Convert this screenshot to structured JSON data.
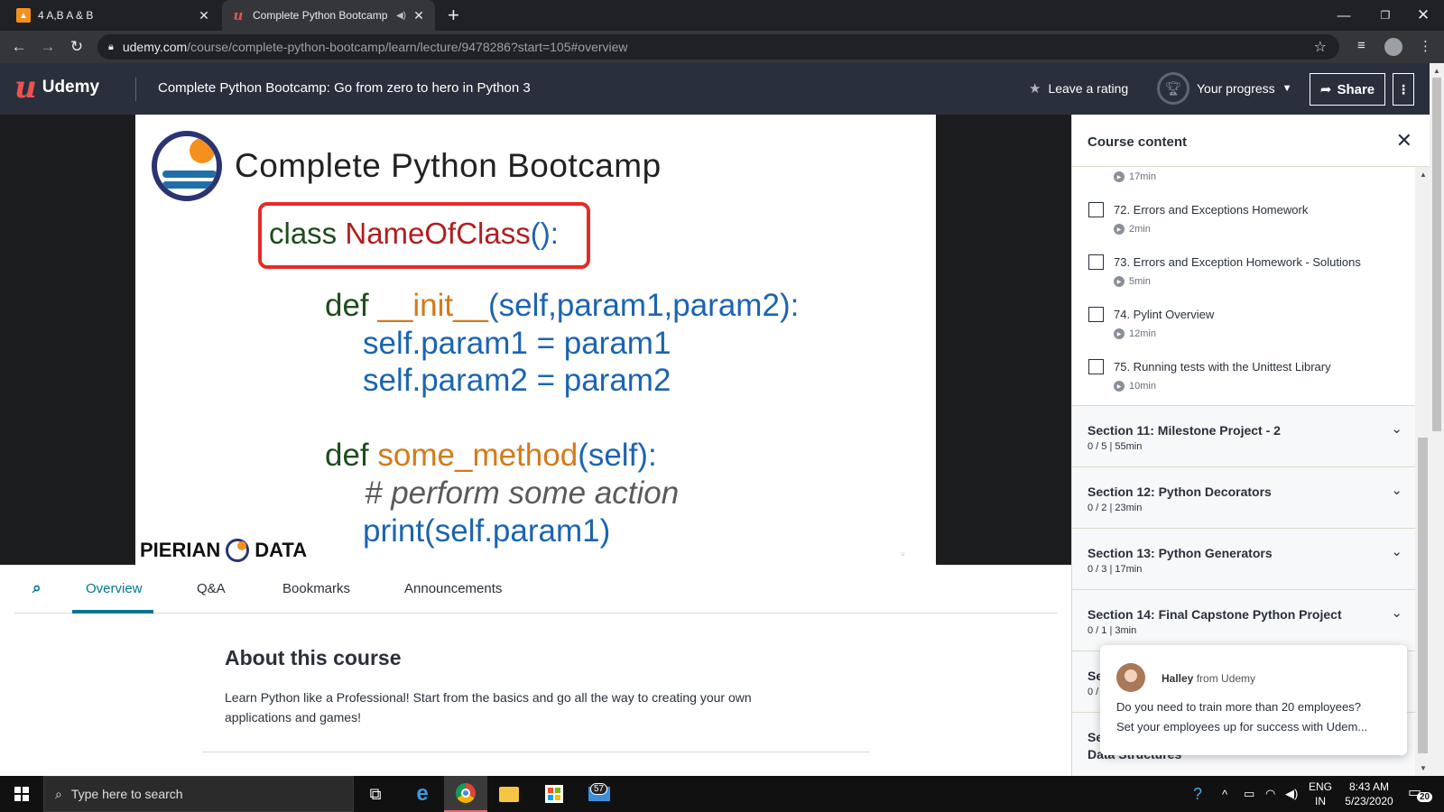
{
  "browser": {
    "tabs": [
      {
        "title": "4 A,B A & B",
        "active": false
      },
      {
        "title": "Complete Python Bootcamp",
        "active": true
      }
    ],
    "url_host": "udemy.com",
    "url_path": "/course/complete-python-bootcamp/learn/lecture/9478286?start=105#overview"
  },
  "header": {
    "logo_text": "Udemy",
    "course_title": "Complete Python Bootcamp: Go from zero to hero in Python 3",
    "rating_label": "Leave a rating",
    "progress_label": "Your progress",
    "share_label": "Share"
  },
  "slide": {
    "title": "Complete Python Bootcamp",
    "class_kw": "class",
    "class_name": "NameOfClass",
    "class_end": "():",
    "line1_kw": "def",
    "line1_fn": "__init__",
    "line1_args_open": "(",
    "line1_self": "self,",
    "line1_params": "param1,param2",
    "line1_close": "):",
    "line2": "self.param1 = param1",
    "line3": "self.param2 = param2",
    "line4_kw": "def",
    "line4_fn": "some_method",
    "line4_args": "(self):",
    "line5": "# perform some action",
    "line6": "print(self.param1)",
    "brand_left": "PIERIAN",
    "brand_right": "DATA"
  },
  "subnav": {
    "tabs": [
      "Overview",
      "Q&A",
      "Bookmarks",
      "Announcements"
    ],
    "active": "Overview"
  },
  "about": {
    "title": "About this course",
    "text": "Learn Python like a Professional! Start from the basics and go all the way to creating your own applications and games!"
  },
  "sidebar": {
    "title": "Course content",
    "top_duration": "17min",
    "lectures": [
      {
        "title": "72. Errors and Exceptions Homework",
        "duration": "2min"
      },
      {
        "title": "73. Errors and Exception Homework - Solutions",
        "duration": "5min"
      },
      {
        "title": "74. Pylint Overview",
        "duration": "12min"
      },
      {
        "title": "75. Running tests with the Unittest Library",
        "duration": "10min"
      }
    ],
    "sections": [
      {
        "title": "Section 11: Milestone Project - 2",
        "meta": "0 / 5 | 55min"
      },
      {
        "title": "Section 12: Python Decorators",
        "meta": "0 / 2 | 23min"
      },
      {
        "title": "Section 13: Python Generators",
        "meta": "0 / 3 | 17min"
      },
      {
        "title": "Section 14: Final Capstone Python Project",
        "meta": "0 / 1 | 3min"
      },
      {
        "title": "Se",
        "meta": "0 /"
      },
      {
        "title": "Se",
        "meta": ""
      }
    ],
    "partial_section_title": "Data Structures"
  },
  "chat": {
    "sender": "Halley",
    "from_label": "from Udemy",
    "line1": "Do you need to train more than 20 employees?",
    "line2": "Set your employees up for success with Udem..."
  },
  "taskbar": {
    "search_placeholder": "Type here to search",
    "mail_badge": "57",
    "lang_line1": "ENG",
    "lang_line2": "IN",
    "time": "8:43 AM",
    "date": "5/23/2020",
    "notif_count": "20"
  }
}
